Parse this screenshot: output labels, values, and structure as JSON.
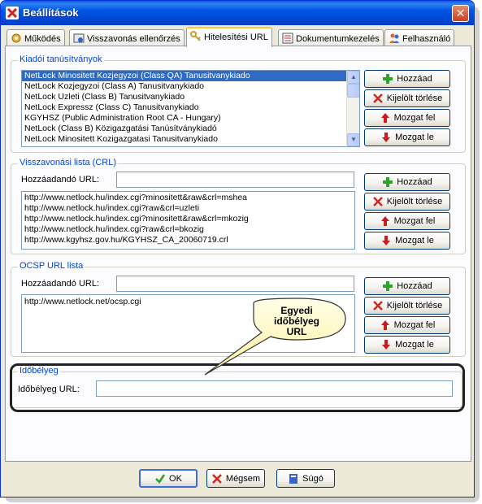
{
  "window": {
    "title": "Beállítások",
    "close_glyph": "✕"
  },
  "tabs": [
    {
      "label": "Működés",
      "icon": "gear-user-icon"
    },
    {
      "label": "Visszavonás ellenőrzés",
      "icon": "certificate-icon"
    },
    {
      "label": "Hitelesítési URL",
      "icon": "key-icon",
      "active": true
    },
    {
      "label": "Dokumentumkezelés",
      "icon": "document-list-icon"
    },
    {
      "label": "Felhasználó",
      "icon": "users-icon"
    }
  ],
  "issuers": {
    "legend": "Kiadói tanúsítványok",
    "items": [
      "NetLock Minositett Kozjegyzoi (Class QA) Tanusitvanykiado",
      "NetLock Kozjegyzoi (Class A) Tanusitvanykiado",
      "NetLock Uzleti (Class B) Tanusitvanykiado",
      "NetLock Expressz (Class C) Tanusitvanykiado",
      "KGYHSZ (Public Administration Root CA - Hungary)",
      "NetLock (Class B) Közigazgatási Tanúsítványkiadó",
      "NetLock Minositett Kozigazgatasi Tanusitvanykiado"
    ],
    "selected_index": 0,
    "buttons": {
      "add": "Hozzáad",
      "delete": "Kijelölt törlése",
      "up": "Mozgat fel",
      "down": "Mozgat le"
    }
  },
  "crl": {
    "legend": "Visszavonási lista (CRL)",
    "add_label": "Hozzáadandó URL:",
    "add_value": "",
    "items": [
      "http://www.netlock.hu/index.cgi?minositett&raw&crl=mshea",
      "http://www.netlock.hu/index.cgi?raw&crl=uzleti",
      "http://www.netlock.hu/index.cgi?minositett&raw&crl=mkozig",
      "http://www.netlock.hu/index.cgi?raw&crl=bkozig",
      "http://www.kgyhsz.gov.hu/KGYHSZ_CA_20060719.crl"
    ],
    "buttons": {
      "add": "Hozzáad",
      "delete": "Kijelölt törlése",
      "up": "Mozgat fel",
      "down": "Mozgat le"
    }
  },
  "ocsp": {
    "legend": "OCSP URL lista",
    "add_label": "Hozzáadandó URL:",
    "add_value": "",
    "items": [
      "http://www.netlock.net/ocsp.cgi"
    ],
    "buttons": {
      "add": "Hozzáad",
      "delete": "Kijelölt törlése",
      "up": "Mozgat fel",
      "down": "Mozgat le"
    }
  },
  "callout": {
    "line1": "Egyedi",
    "line2": "időbélyeg",
    "line3": "URL"
  },
  "timestamp": {
    "legend": "Időbélyeg",
    "label": "Időbélyeg URL:",
    "value": ""
  },
  "footer": {
    "ok": "OK",
    "cancel": "Mégsem",
    "help": "Súgó"
  },
  "colors": {
    "accent": "#316ac5",
    "legend": "#0046d5",
    "add_green": "#2ea12e",
    "delete_red": "#d0281e",
    "arrow_red": "#c81e1e"
  }
}
